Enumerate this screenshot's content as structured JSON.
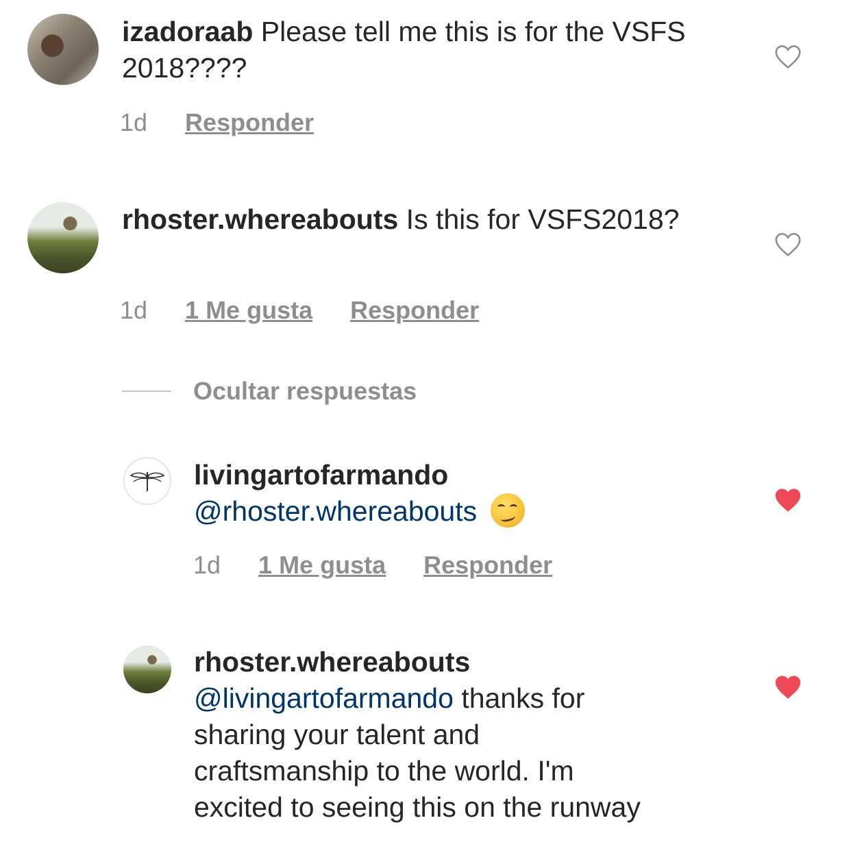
{
  "comments": [
    {
      "username": "izadoraab",
      "text": " Please tell me this is for the VSFS 2018????",
      "time": "1d",
      "reply_label": "Responder",
      "liked": false
    },
    {
      "username": "rhoster.whereabouts",
      "text": " Is this for VSFS2018?",
      "time": "1d",
      "likes_label": "1 Me gusta",
      "reply_label": "Responder",
      "liked": false
    }
  ],
  "hide_replies_label": "Ocultar respuestas",
  "replies": [
    {
      "username": "livingartofarmando",
      "mention": "@rhoster.whereabouts",
      "text": "",
      "emoji": "smirking-face",
      "time": "1d",
      "likes_label": "1 Me gusta",
      "reply_label": "Responder",
      "liked": true
    },
    {
      "username": "rhoster.whereabouts",
      "mention": "@livingartofarmando",
      "text_line1": " thanks for",
      "text_line2": "sharing your talent and",
      "text_line3": "craftsmanship to the world. I'm",
      "text_line4": "excited to seeing this on the runway",
      "liked": true
    }
  ],
  "colors": {
    "text": "#262626",
    "muted": "#8e8e8e",
    "mention": "#003569",
    "heart_liked": "#ed4956",
    "heart_outline": "#8e8e8e"
  },
  "icons": {
    "like": "heart-outline-icon",
    "liked": "heart-filled-icon"
  }
}
